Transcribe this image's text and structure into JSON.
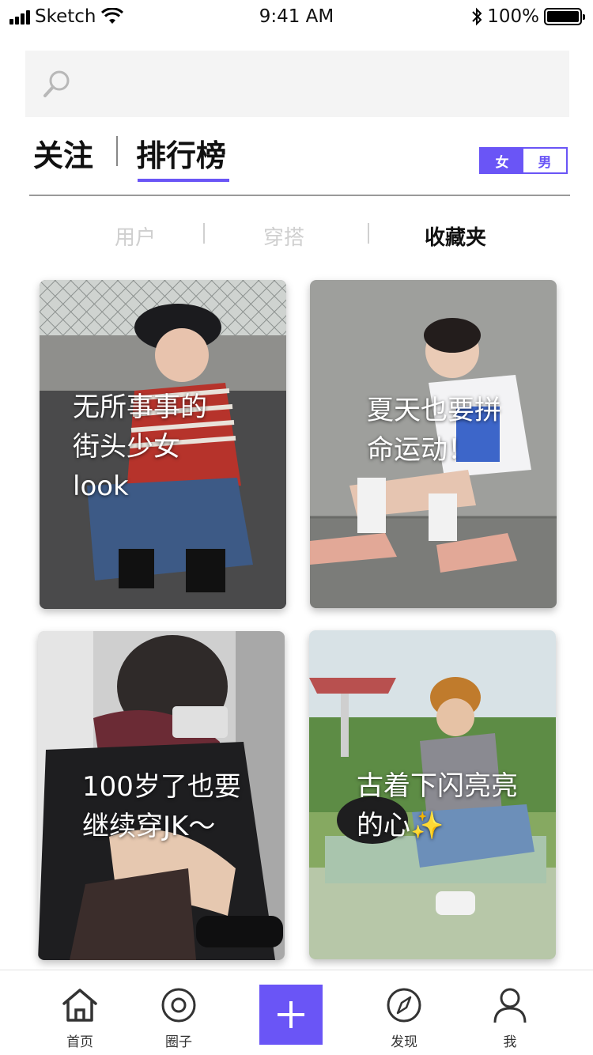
{
  "status_bar": {
    "carrier": "Sketch",
    "time": "9:41 AM",
    "battery": "100%"
  },
  "search": {
    "placeholder": "",
    "value": ""
  },
  "top_tabs": {
    "follow": "关注",
    "ranking": "排行榜",
    "active": "ranking"
  },
  "gender_toggle": {
    "female": "女",
    "male": "男",
    "selected": "female"
  },
  "sub_tabs": {
    "users": "用户",
    "outfits": "穿搭",
    "favorites": "收藏夹",
    "active": "favorites"
  },
  "cards": [
    {
      "caption": "无所事事的\n街头少女\nlook"
    },
    {
      "caption": "夏天也要拼\n命运动！"
    },
    {
      "caption": "100岁了也要\n继续穿JK～"
    },
    {
      "caption": "古着下闪亮亮\n的心✨"
    }
  ],
  "bottom_nav": {
    "home": "首页",
    "circle": "圈子",
    "discover": "发现",
    "me": "我"
  },
  "colors": {
    "accent": "#6a55f6",
    "search_bg": "#f4f4f4",
    "inactive_tab": "#cfcfcf"
  },
  "icons": [
    "search-icon",
    "home-icon",
    "circle-icon",
    "add-icon",
    "compass-icon",
    "user-icon",
    "wifi-icon",
    "bluetooth-icon",
    "battery-icon",
    "signal-icon"
  ]
}
